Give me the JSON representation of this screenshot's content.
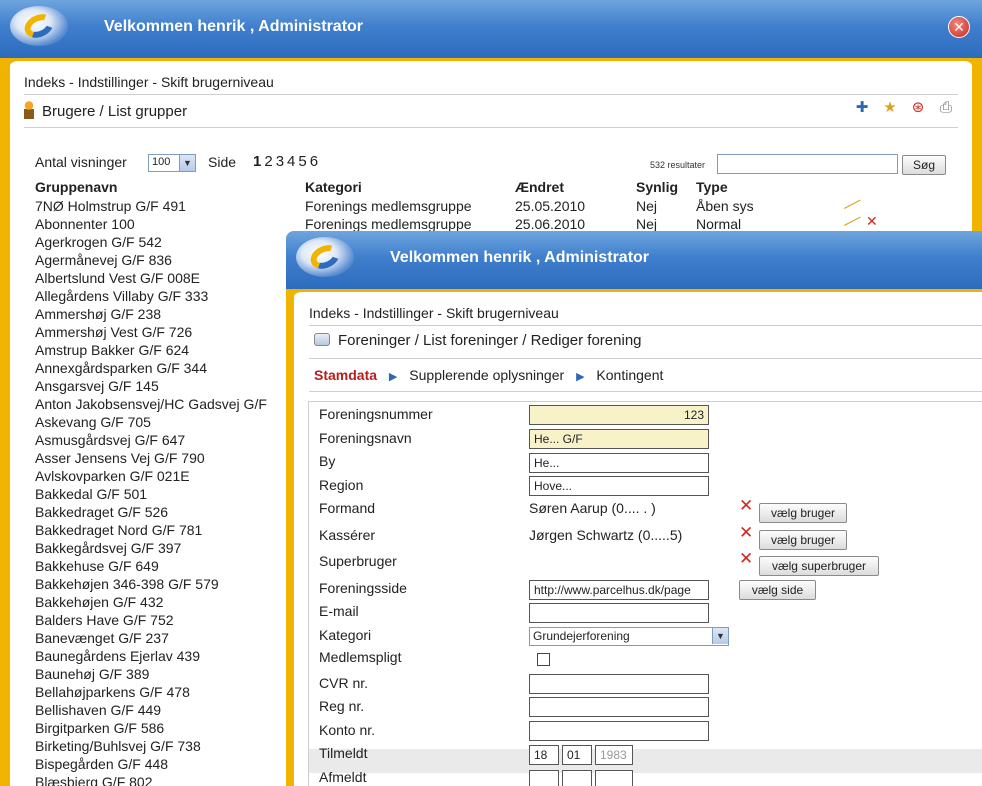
{
  "window_back": {
    "title": "Velkommen henrik , Administrator",
    "breadcrumb": "Indeks - Indstillinger - Skift brugerniveau",
    "page_title": "Brugere / List grupper",
    "filter": {
      "antal_label": "Antal visninger",
      "antal_value": "100",
      "side_label": "Side",
      "pages": [
        "1",
        "2",
        "3",
        "4",
        "5",
        "6"
      ],
      "results": "532 resultater",
      "search_value": "",
      "search_button": "Søg"
    },
    "columns": [
      "Gruppenavn",
      "Kategori",
      "Ændret",
      "Synlig",
      "Type"
    ],
    "rows_detail": [
      {
        "kategori": "Forenings medlemsgruppe",
        "aendret": "25.05.2010",
        "synlig": "Nej",
        "type": "Åben sys"
      },
      {
        "kategori": "Forenings medlemsgruppe",
        "aendret": "25.06.2010",
        "synlig": "Nej",
        "type": "Normal"
      }
    ],
    "groups": [
      "7NØ Holmstrup G/F 491",
      "Abonnenter 100",
      "Agerkrogen G/F 542",
      "Agermånevej G/F 836",
      "Albertslund Vest G/F 008E",
      "Allegårdens Villaby G/F 333",
      "Ammershøj G/F 238",
      "Ammershøj Vest G/F 726",
      "Amstrup Bakker G/F 624",
      "Annexgårdsparken G/F 344",
      "Ansgarsvej G/F 145",
      "Anton Jakobsensvej/HC Gadsvej G/F",
      "Askevang G/F 705",
      "Asmusgårdsvej G/F 647",
      "Asser Jensens Vej G/F 790",
      "Avlskovparken G/F 021E",
      "Bakkedal G/F 501",
      "Bakkedraget G/F 526",
      "Bakkedraget Nord G/F 781",
      "Bakkegårdsvej G/F 397",
      "Bakkehuse G/F 649",
      "Bakkehøjen 346-398 G/F 579",
      "Bakkehøjen G/F 432",
      "Balders Have G/F 752",
      "Banevænget G/F 237",
      "Baunegårdens Ejerlav 439",
      "Baunehøj G/F 389",
      "Bellahøjparkens G/F 478",
      "Bellishaven G/F 449",
      "Birgitparken G/F 586",
      "Birketing/Buhlsvej G/F 738",
      "Bispegården G/F 448",
      "Blæsbjerg G/F 802"
    ]
  },
  "window_front": {
    "title": "Velkommen henrik , Administrator",
    "breadcrumb": "Indeks - Indstillinger - Skift brugerniveau",
    "page_title": "Foreninger / List foreninger / Rediger forening",
    "tabs": [
      "Stamdata",
      "Supplerende oplysninger",
      "Kontingent"
    ],
    "form": {
      "foreningsnummer": {
        "label": "Foreningsnummer",
        "value": "123"
      },
      "foreningsnavn": {
        "label": "Foreningsnavn",
        "value": "He... G/F"
      },
      "by": {
        "label": "By",
        "value": "He..."
      },
      "region": {
        "label": "Region",
        "value": "Hove..."
      },
      "formand": {
        "label": "Formand",
        "value": "Søren Aarup (0.... . )",
        "button": "vælg bruger"
      },
      "kasserer": {
        "label": "Kassérer",
        "value": "Jørgen Schwartz (0.....5)",
        "button": "vælg bruger"
      },
      "superbruger": {
        "label": "Superbruger",
        "value": "",
        "button": "vælg superbruger"
      },
      "foreningsside": {
        "label": "Foreningsside",
        "value": "http://www.parcelhus.dk/page",
        "button": "vælg side"
      },
      "email": {
        "label": "E-mail",
        "value": ""
      },
      "kategori": {
        "label": "Kategori",
        "value": "Grundejerforening"
      },
      "medlemspligt": {
        "label": "Medlemspligt"
      },
      "cvr": {
        "label": "CVR nr.",
        "value": ""
      },
      "reg": {
        "label": "Reg nr.",
        "value": ""
      },
      "konto": {
        "label": "Konto nr.",
        "value": ""
      },
      "tilmeldt": {
        "label": "Tilmeldt",
        "day": "18",
        "month": "01",
        "year": "1983"
      },
      "afmeldt": {
        "label": "Afmeldt"
      }
    }
  },
  "colors": {
    "title_bar": "#3f7fcd",
    "frame": "#f0b400",
    "active_tab": "#b81d1d",
    "delete": "#d0281e"
  }
}
